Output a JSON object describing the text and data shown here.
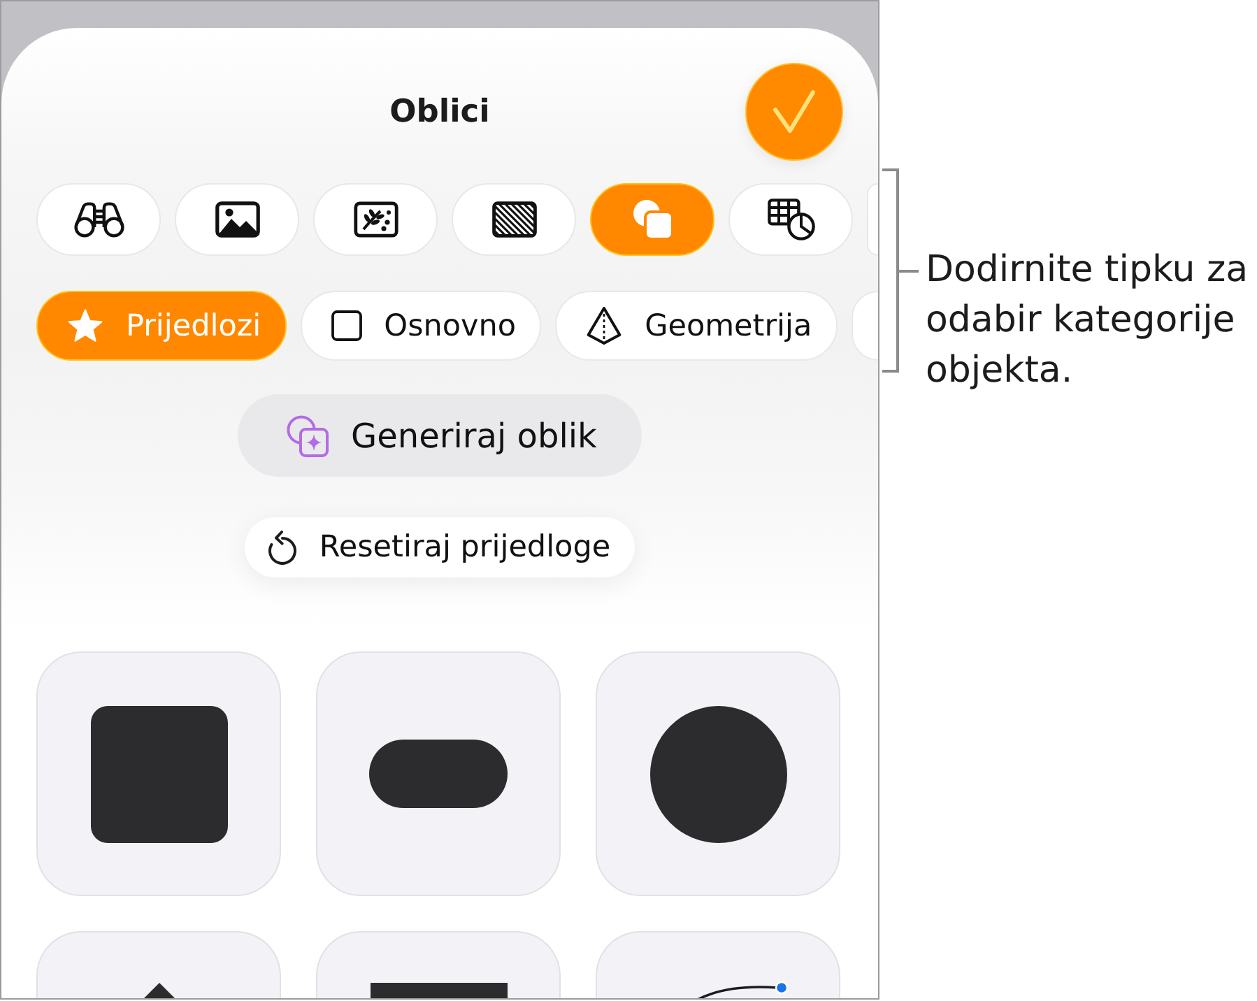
{
  "header": {
    "title": "Oblici"
  },
  "insert_tabs": [
    {
      "kind": "binoculars",
      "selected": false
    },
    {
      "kind": "photo",
      "selected": false
    },
    {
      "kind": "leaf-picture",
      "selected": false
    },
    {
      "kind": "hatched",
      "selected": false
    },
    {
      "kind": "shapes",
      "selected": true
    },
    {
      "kind": "table-chart",
      "selected": false
    },
    {
      "selected": false
    }
  ],
  "categories": [
    {
      "kind": "star",
      "label": "Prijedlozi",
      "selected": true
    },
    {
      "kind": "square",
      "label": "Osnovno",
      "selected": false
    },
    {
      "kind": "pyramid",
      "label": "Geometrija",
      "selected": false
    },
    {
      "selected": false
    }
  ],
  "generate_button": {
    "label": "Generiraj oblik"
  },
  "reset_button": {
    "label": "Resetiraj prijedloge"
  },
  "shapes": [
    {
      "kind": "rounded-square"
    },
    {
      "kind": "capsule"
    },
    {
      "kind": "circle"
    },
    {
      "kind": "triangle"
    },
    {
      "kind": "rectangle"
    },
    {
      "kind": "curve"
    }
  ],
  "callout": {
    "text": "Dodirnite tipku za odabir kategorije objekta."
  }
}
